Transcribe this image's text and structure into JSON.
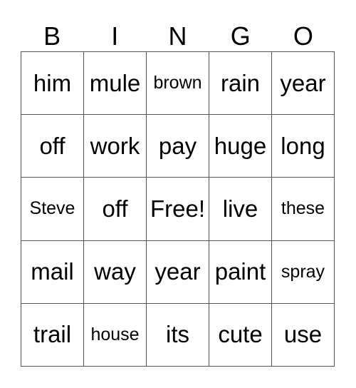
{
  "header": [
    "B",
    "I",
    "N",
    "G",
    "O"
  ],
  "cells": [
    [
      "him",
      "mule",
      "brown",
      "rain",
      "year"
    ],
    [
      "off",
      "work",
      "pay",
      "huge",
      "long"
    ],
    [
      "Steve",
      "off",
      "Free!",
      "live",
      "these"
    ],
    [
      "mail",
      "way",
      "year",
      "paint",
      "spray"
    ],
    [
      "trail",
      "house",
      "its",
      "cute",
      "use"
    ]
  ]
}
